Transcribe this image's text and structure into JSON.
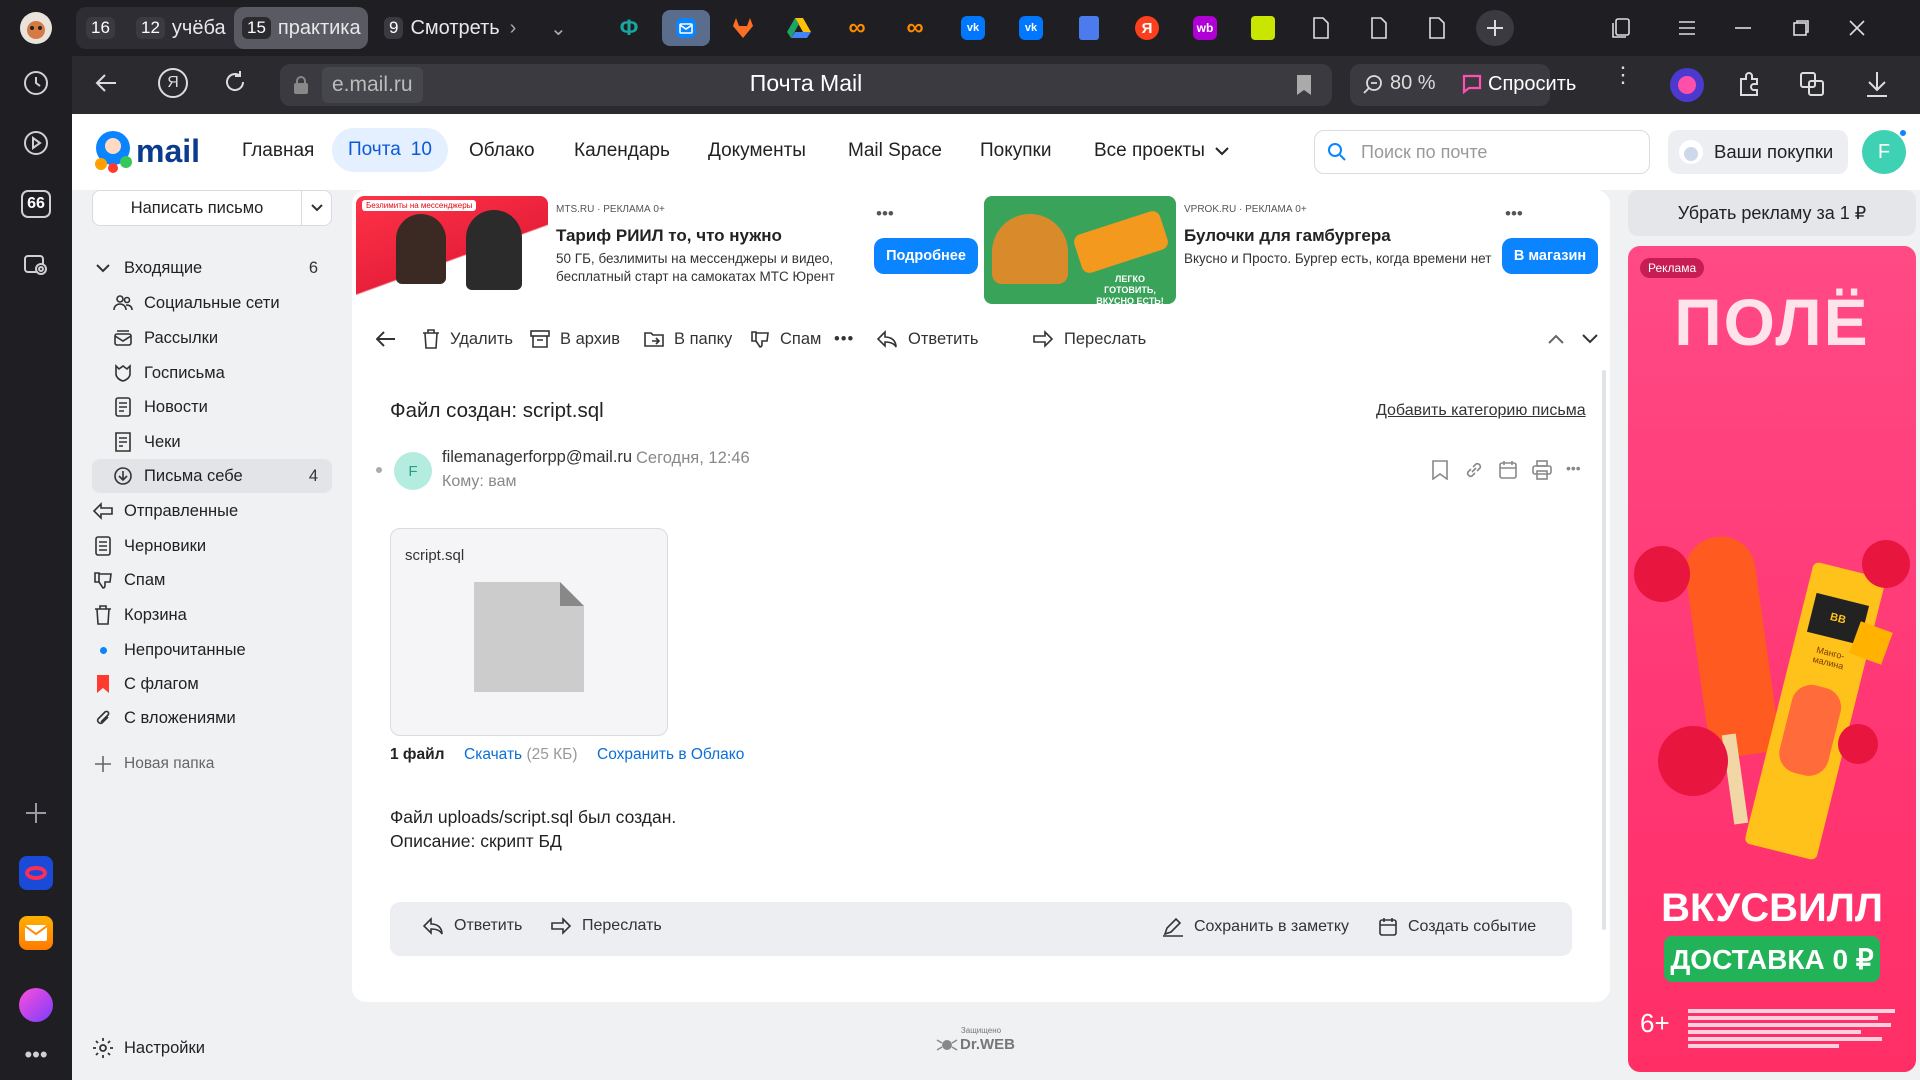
{
  "browser": {
    "tabs": [
      {
        "count": "16",
        "label": ""
      },
      {
        "count": "12",
        "label": "учёба"
      },
      {
        "count": "15",
        "label": "практика"
      },
      {
        "count": "9",
        "label": "Смотреть"
      }
    ],
    "address": "e.mail.ru",
    "page_title": "Почта Mail",
    "zoom": "80 %",
    "ask_label": "Спросить"
  },
  "header": {
    "logo": "mail",
    "nav": [
      {
        "label": "Главная"
      },
      {
        "label": "Почта",
        "badge": "10"
      },
      {
        "label": "Облако"
      },
      {
        "label": "Календарь"
      },
      {
        "label": "Документы"
      },
      {
        "label": "Mail Space"
      },
      {
        "label": "Покупки"
      },
      {
        "label": "Все проекты"
      }
    ],
    "search_placeholder": "Поиск по почте",
    "purchases": "Ваши покупки",
    "avatar_letter": "F"
  },
  "sidebar": {
    "compose": "Написать письмо",
    "folders": [
      {
        "label": "Входящие",
        "count": "6"
      },
      {
        "label": "Социальные сети"
      },
      {
        "label": "Рассылки"
      },
      {
        "label": "Госписьма"
      },
      {
        "label": "Новости"
      },
      {
        "label": "Чеки"
      },
      {
        "label": "Письма себе",
        "count": "4"
      },
      {
        "label": "Отправленные"
      },
      {
        "label": "Черновики"
      },
      {
        "label": "Спам"
      },
      {
        "label": "Корзина"
      },
      {
        "label": "Непрочитанные"
      },
      {
        "label": "С флагом"
      },
      {
        "label": "С вложениями"
      }
    ],
    "new_folder": "Новая папка",
    "settings": "Настройки"
  },
  "ads": [
    {
      "source": "MTS.RU",
      "tag": "РЕКЛАМА 0+",
      "title": "Тариф РИИЛ то, что нужно",
      "text": "50 ГБ, безлимиты на мессенджеры и видео, бесплатный старт на самокатах МТС Юрент",
      "button": "Подробнее",
      "image_badge": "Безлимиты на мессенджеры"
    },
    {
      "source": "VPROK.RU",
      "tag": "РЕКЛАМА 0+",
      "title": "Булочки для гамбургера",
      "text": "Вкусно и Просто. Бургер есть, когда времени нет",
      "button": "В магазин",
      "image_caption": "ЛЕГКО ГОТОВИТЬ, ВКУСНО ЕСТЬ!"
    }
  ],
  "toolbar": {
    "delete": "Удалить",
    "archive": "В архив",
    "to_folder": "В папку",
    "spam": "Спам",
    "reply": "Ответить",
    "forward": "Переслать"
  },
  "message": {
    "subject": "Файл создан: script.sql",
    "add_category": "Добавить категорию письма",
    "sender_initial": "F",
    "sender": "filemanagerforpp@mail.ru",
    "date": "Сегодня, 12:46",
    "to": "Кому: вам",
    "attachment_name": "script.sql",
    "files_count": "1 файл",
    "download": "Скачать",
    "size": "(25 КБ)",
    "save_cloud": "Сохранить в Облако",
    "body_line1": "Файл uploads/script.sql был создан.",
    "body_line2": "Описание: скрипт БД"
  },
  "bottom_bar": {
    "reply": "Ответить",
    "forward": "Переслать",
    "save_note": "Сохранить в заметку",
    "create_event": "Создать событие"
  },
  "right": {
    "remove_ads": "Убрать рекламу за 1 ₽",
    "ad_tag": "Реклама",
    "ad_title": "ПОЛЁ",
    "ad_brand": "ВКУСВИЛЛ",
    "ad_delivery": "ДОСТАВКА 0 ₽",
    "ad_age": "6+",
    "ad_pack_brand": "ВВ",
    "ad_pack_flavor": "Манго-малина"
  },
  "footer": {
    "protected": "Защищено",
    "drweb": "Dr.WEB"
  },
  "colors": {
    "accent": "#0077ff",
    "dark_bg": "#1f1f23",
    "ad_pink": "#ff3e7f"
  }
}
